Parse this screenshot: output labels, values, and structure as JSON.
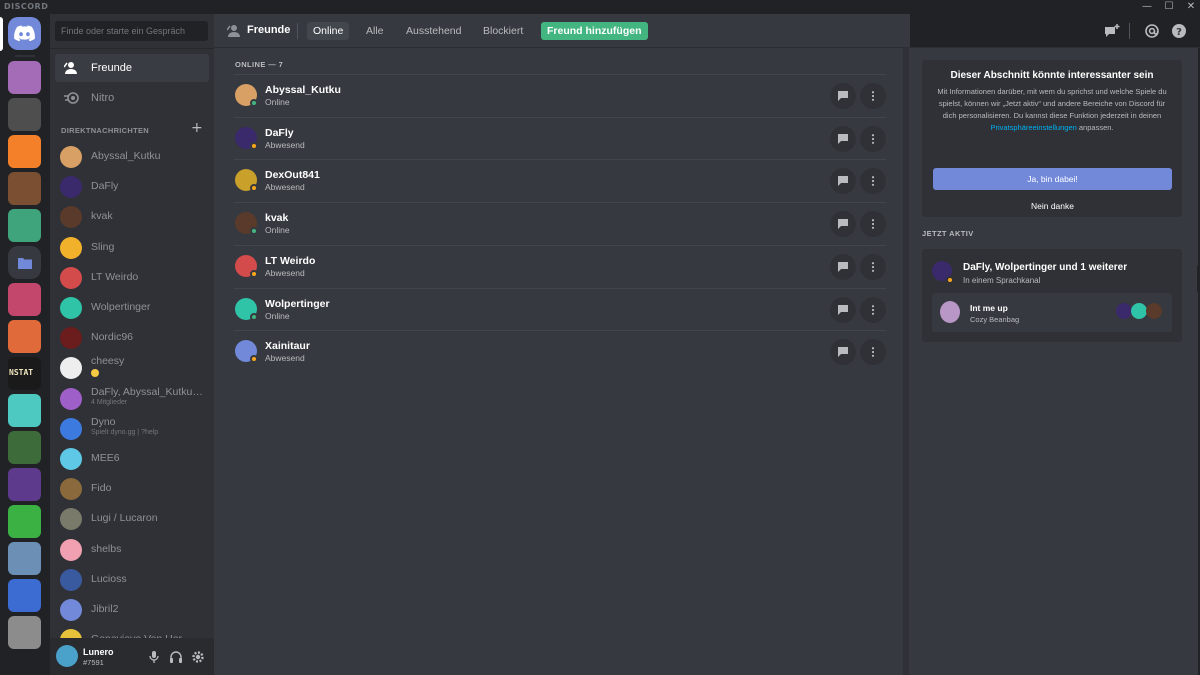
{
  "window": {
    "brand": "DISCORD",
    "controls": [
      "—",
      "☐",
      "✕"
    ]
  },
  "servers": [
    {
      "name": "home",
      "color": "#7289da"
    },
    {
      "name": "server-1",
      "color": "#a46cb7"
    },
    {
      "name": "server-2",
      "color": "#4e4e4e"
    },
    {
      "name": "server-3",
      "color": "#f4802a"
    },
    {
      "name": "server-4",
      "color": "#7a4f32"
    },
    {
      "name": "server-5",
      "color": "#3fa47b"
    },
    {
      "name": "folder",
      "color": "#36393f"
    },
    {
      "name": "server-6",
      "color": "#c3476c"
    },
    {
      "name": "server-7",
      "color": "#e06a3a"
    },
    {
      "name": "server-8",
      "color": "#1a1a1a"
    },
    {
      "name": "server-9",
      "color": "#4dc9c1"
    },
    {
      "name": "server-10",
      "color": "#3d6b3a"
    },
    {
      "name": "server-11",
      "color": "#5d3a8c"
    },
    {
      "name": "server-12",
      "color": "#3bb143"
    },
    {
      "name": "server-13",
      "color": "#6b8fb5"
    },
    {
      "name": "server-14",
      "color": "#3c6bd1"
    },
    {
      "name": "server-15",
      "color": "#8c8c8c"
    }
  ],
  "server_badges": {
    "nstat": "NSTAT"
  },
  "sidebar": {
    "search_placeholder": "Finde oder starte ein Gespräch",
    "nav": [
      {
        "label": "Freunde",
        "icon": "friends-icon"
      },
      {
        "label": "Nitro",
        "icon": "nitro-icon"
      }
    ],
    "dm_header": "DIREKTNACHRICHTEN",
    "dms": [
      {
        "name": "Abyssal_Kutku",
        "color": "#d9a066"
      },
      {
        "name": "DaFly",
        "color": "#3a2a6b"
      },
      {
        "name": "kvak",
        "color": "#5a3a2a"
      },
      {
        "name": "Sling",
        "color": "#f2b12b"
      },
      {
        "name": "LT Weirdo",
        "color": "#d34b4b"
      },
      {
        "name": "Wolpertinger",
        "color": "#2fc4a8"
      },
      {
        "name": "Nordic96",
        "color": "#6b1d1d"
      },
      {
        "name": "cheesy",
        "color": "#eeeeee",
        "emoji": true
      },
      {
        "name": "DaFly, Abyssal_Kutku, ...",
        "sub": "4 Mitglieder",
        "color": "#9e5fc8"
      },
      {
        "name": "Dyno",
        "sub": "Spielt dyno.gg | ?help",
        "color": "#3d7ae0"
      },
      {
        "name": "MEE6",
        "color": "#5ec8e6"
      },
      {
        "name": "Fido",
        "color": "#8a6a3c"
      },
      {
        "name": "Lugi / Lucaron",
        "color": "#7a7a6a"
      },
      {
        "name": "shelbs",
        "color": "#f0a0b0"
      },
      {
        "name": "Lucioss",
        "color": "#3a5aa0"
      },
      {
        "name": "Jibril2",
        "color": "#7289da"
      },
      {
        "name": "Genevieve Von Her...",
        "color": "#e6c23a"
      }
    ]
  },
  "user": {
    "name": "Lunero",
    "tag": "#7591"
  },
  "topbar": {
    "title": "Freunde",
    "tabs": [
      "Online",
      "Alle",
      "Ausstehend",
      "Blockiert"
    ],
    "add_friend": "Freund hinzufügen"
  },
  "friends": {
    "header": "ONLINE — 7",
    "list": [
      {
        "name": "Abyssal_Kutku",
        "status": "Online",
        "state": "online",
        "color": "#d9a066"
      },
      {
        "name": "DaFly",
        "status": "Abwesend",
        "state": "idle",
        "color": "#3a2a6b"
      },
      {
        "name": "DexOut841",
        "status": "Abwesend",
        "state": "idle",
        "color": "#c8a02a"
      },
      {
        "name": "kvak",
        "status": "Online",
        "state": "online",
        "color": "#5a3a2a"
      },
      {
        "name": "LT Weirdo",
        "status": "Abwesend",
        "state": "idle",
        "color": "#d34b4b"
      },
      {
        "name": "Wolpertinger",
        "status": "Online",
        "state": "online",
        "color": "#2fc4a8"
      },
      {
        "name": "Xainitaur",
        "status": "Abwesend",
        "state": "idle",
        "color": "#7289da"
      }
    ]
  },
  "status_colors": {
    "online": "#43b581",
    "idle": "#faa61a"
  },
  "aside": {
    "card_title": "Dieser Abschnitt könnte interessanter sein",
    "card_body": "Mit Informationen darüber, mit wem du sprichst und welche Spiele du spielst, können wir „Jetzt aktiv“ und andere Bereiche von Discord für dich personalisieren. Du kannst diese Funktion jederzeit in deinen ",
    "card_link": "Privatsphäreeinstellungen",
    "card_body_end": " anpassen.",
    "yes_button": "Ja, bin dabei!",
    "no_button": "Nein danke",
    "active_header": "JETZT AKTIV",
    "activity_title": "DaFly, Wolpertinger und 1 weiterer",
    "activity_sub": "In einem Sprachkanal",
    "voice_channel": "Int me up",
    "voice_server": "Cozy Beanbag"
  }
}
